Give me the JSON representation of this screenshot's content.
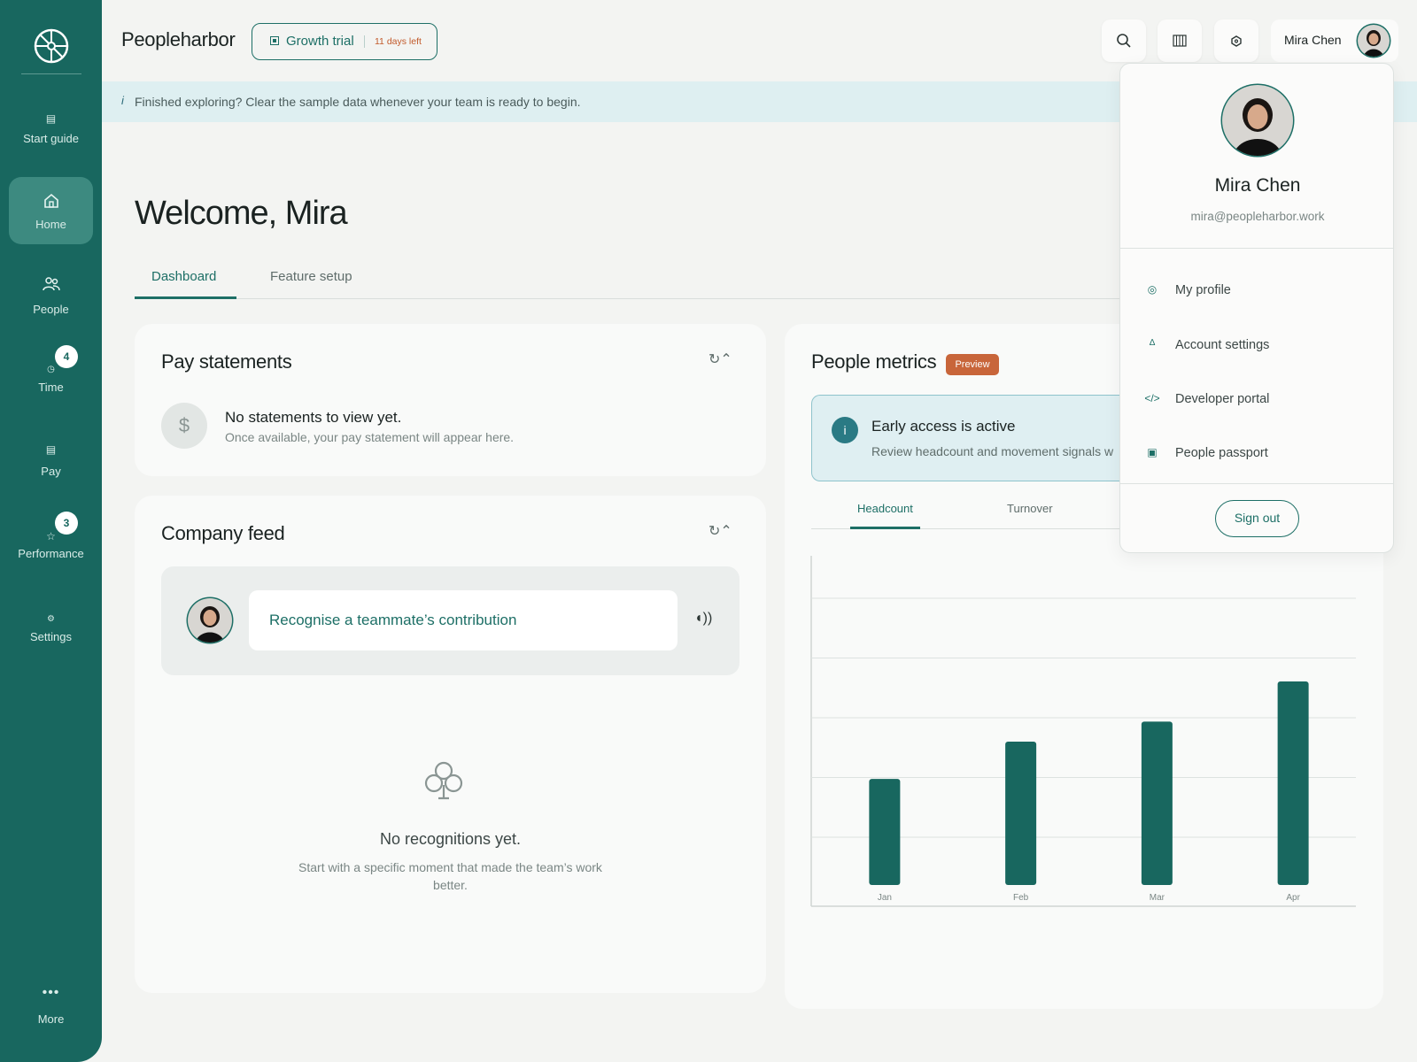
{
  "brand": "Peopleharbor",
  "trial": {
    "label": "Growth trial",
    "days_left": "11 days left"
  },
  "header": {
    "user_name": "Mira Chen",
    "search_icon": "search-icon",
    "grid_icon": "grid-icon",
    "notification_icon": "notification-icon"
  },
  "banner": {
    "icon": "i",
    "text": "Finished exploring? Clear the sample data whenever your team is ready to begin."
  },
  "sidebar": {
    "items": [
      {
        "label": "Start guide",
        "icon": "guide-icon"
      },
      {
        "label": "Home",
        "icon": "home-icon",
        "active": true
      },
      {
        "label": "People",
        "icon": "people-icon"
      },
      {
        "label": "Time",
        "icon": "clock-icon",
        "badge": "4"
      },
      {
        "label": "Pay",
        "icon": "pay-icon"
      },
      {
        "label": "Performance",
        "icon": "star-icon",
        "badge": "3"
      },
      {
        "label": "Settings",
        "icon": "gear-icon"
      }
    ],
    "more": {
      "label": "More",
      "icon": "more-icon"
    }
  },
  "welcome": "Welcome, Mira",
  "tabs": [
    {
      "label": "Dashboard",
      "active": true
    },
    {
      "label": "Feature setup",
      "active": false
    }
  ],
  "pay_statements": {
    "title": "Pay statements",
    "controls": "↻⌃",
    "symbol": "$",
    "empty_title": "No statements to view yet.",
    "empty_sub": "Once available, your pay statement will appear here."
  },
  "company_feed": {
    "title": "Company feed",
    "controls": "↻⌃",
    "input_text": "Recognise a teammate’s contribution",
    "speaker": "◖))",
    "empty_title": "No recognitions yet.",
    "empty_sub": "Start with a specific moment that made the team’s work better."
  },
  "people_metrics": {
    "title": "People metrics",
    "badge": "Preview",
    "early_icon": "i",
    "early_title": "Early access is active",
    "early_sub": "Review headcount and movement signals w",
    "tabs": [
      {
        "label": "Headcount",
        "active": true
      },
      {
        "label": "Turnover",
        "active": false
      }
    ]
  },
  "chart_data": {
    "type": "bar",
    "categories": [
      "Jan",
      "Feb",
      "Mar",
      "Apr"
    ],
    "values": [
      37,
      50,
      57,
      71
    ],
    "ylim": [
      0,
      100
    ],
    "grid": true,
    "color": "#18675f"
  },
  "dropdown": {
    "name": "Mira Chen",
    "email": "mira@peopleharbor.work",
    "items": [
      {
        "label": "My profile",
        "icon": "◎"
      },
      {
        "label": "Account settings",
        "icon": "∆"
      },
      {
        "label": "Developer portal",
        "icon": "</>"
      },
      {
        "label": "People passport",
        "icon": "▣"
      }
    ],
    "sign_out": "Sign out"
  },
  "colors": {
    "primary": "#18675f",
    "accent": "#c8653a",
    "banner": "#deeff1"
  }
}
